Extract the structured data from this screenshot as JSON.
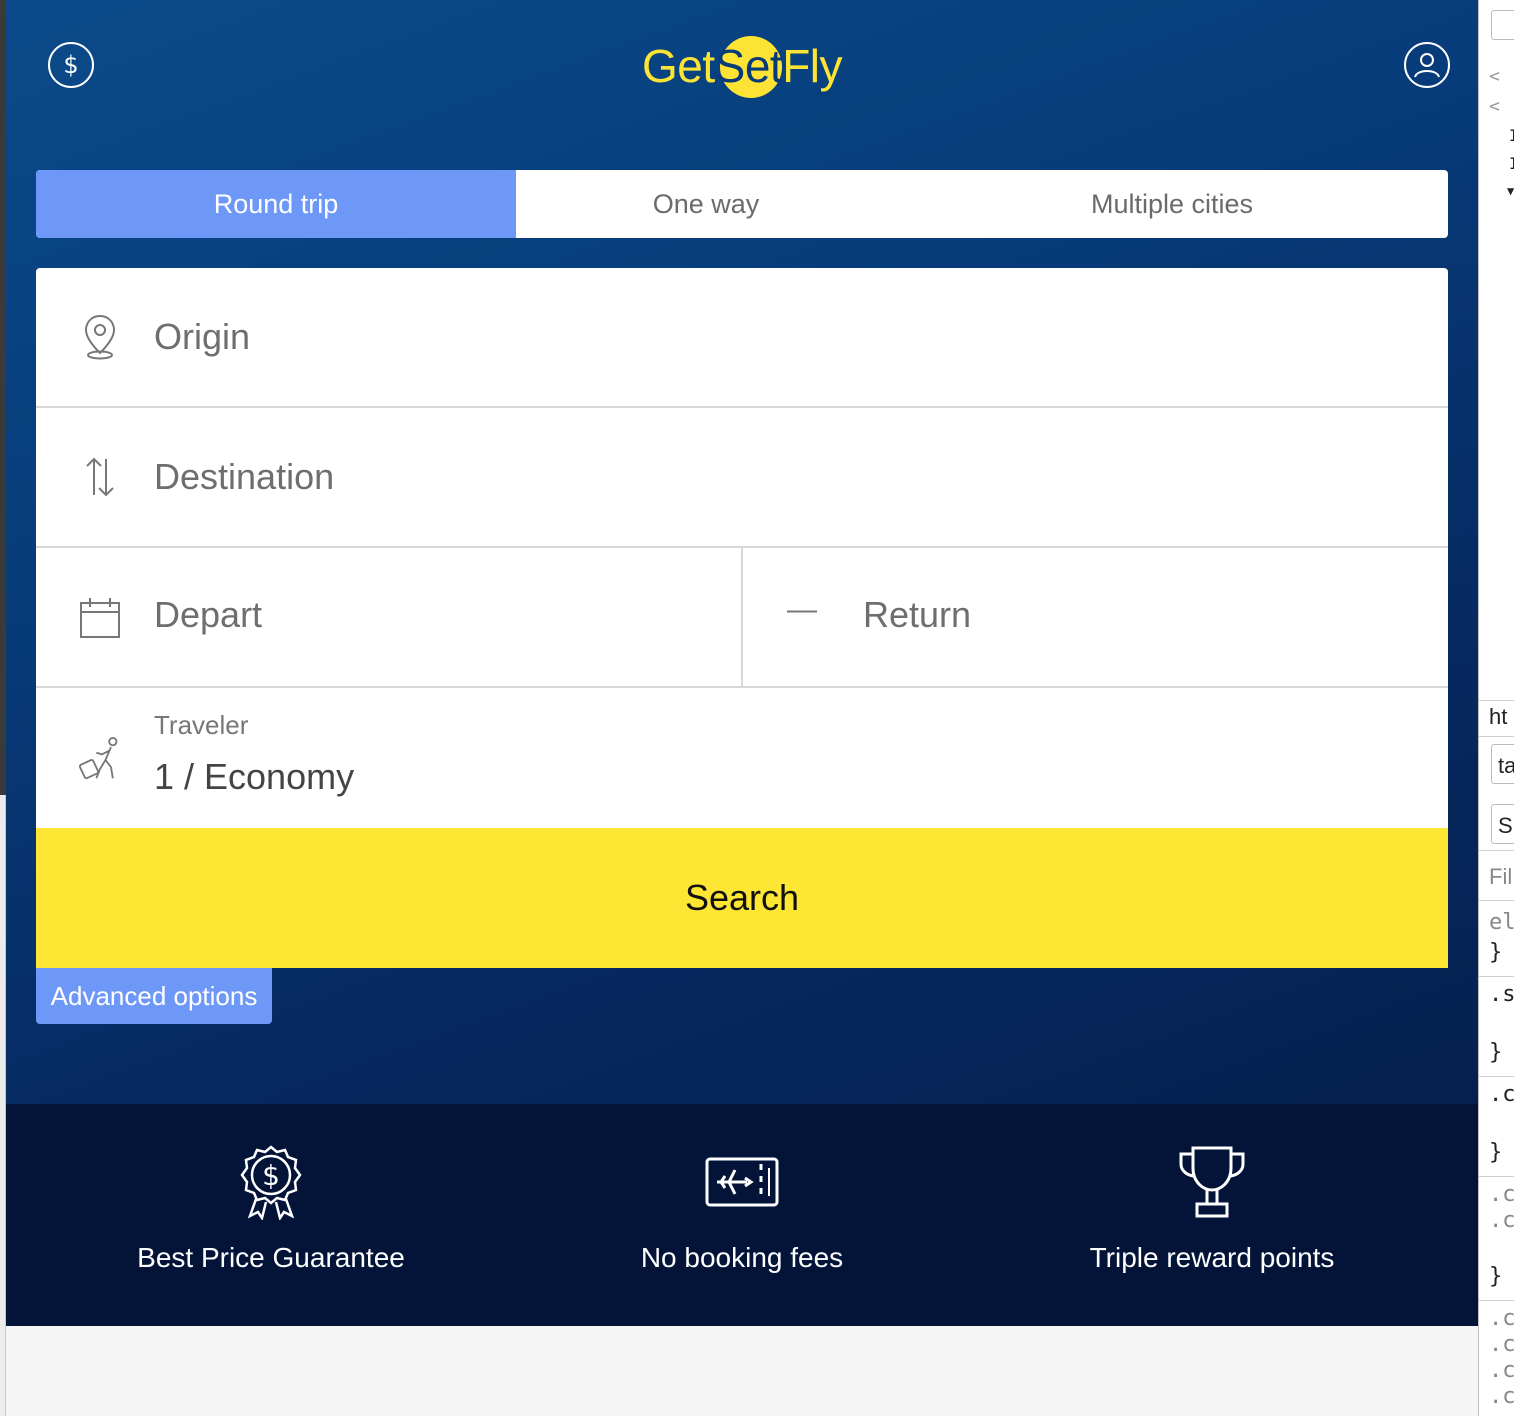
{
  "header": {
    "logo_left": "Get",
    "logo_mid": "Set",
    "logo_right": "Fly",
    "currency_symbol": "$"
  },
  "trip_tabs": [
    {
      "label": "Round trip",
      "active": true
    },
    {
      "label": "One way",
      "active": false
    },
    {
      "label": "Multiple cities",
      "active": false
    }
  ],
  "form": {
    "origin_placeholder": "Origin",
    "destination_placeholder": "Destination",
    "depart_placeholder": "Depart",
    "return_placeholder": "Return",
    "return_dash": "—",
    "traveler_label": "Traveler",
    "traveler_value": "1 / Economy"
  },
  "search_label": "Search",
  "advanced_label": "Advanced options",
  "features": [
    {
      "icon": "price-ribbon-icon",
      "label": "Best Price Guarantee"
    },
    {
      "icon": "ticket-plane-icon",
      "label": "No booking fees"
    },
    {
      "icon": "trophy-icon",
      "label": "Triple reward points"
    }
  ],
  "devtools": {
    "fragments": [
      "<",
      "<",
      "I",
      "I",
      "▼",
      "ht",
      "ta",
      "S",
      "Fil",
      "el",
      "}",
      ".s",
      "}",
      ".c",
      "}",
      ".c",
      ".c",
      "}",
      ".c",
      ".c",
      ".c",
      ".c"
    ]
  },
  "colors": {
    "accent_blue": "#6e98f8",
    "brand_yellow": "#fde434",
    "bg_dark": "#031438"
  }
}
